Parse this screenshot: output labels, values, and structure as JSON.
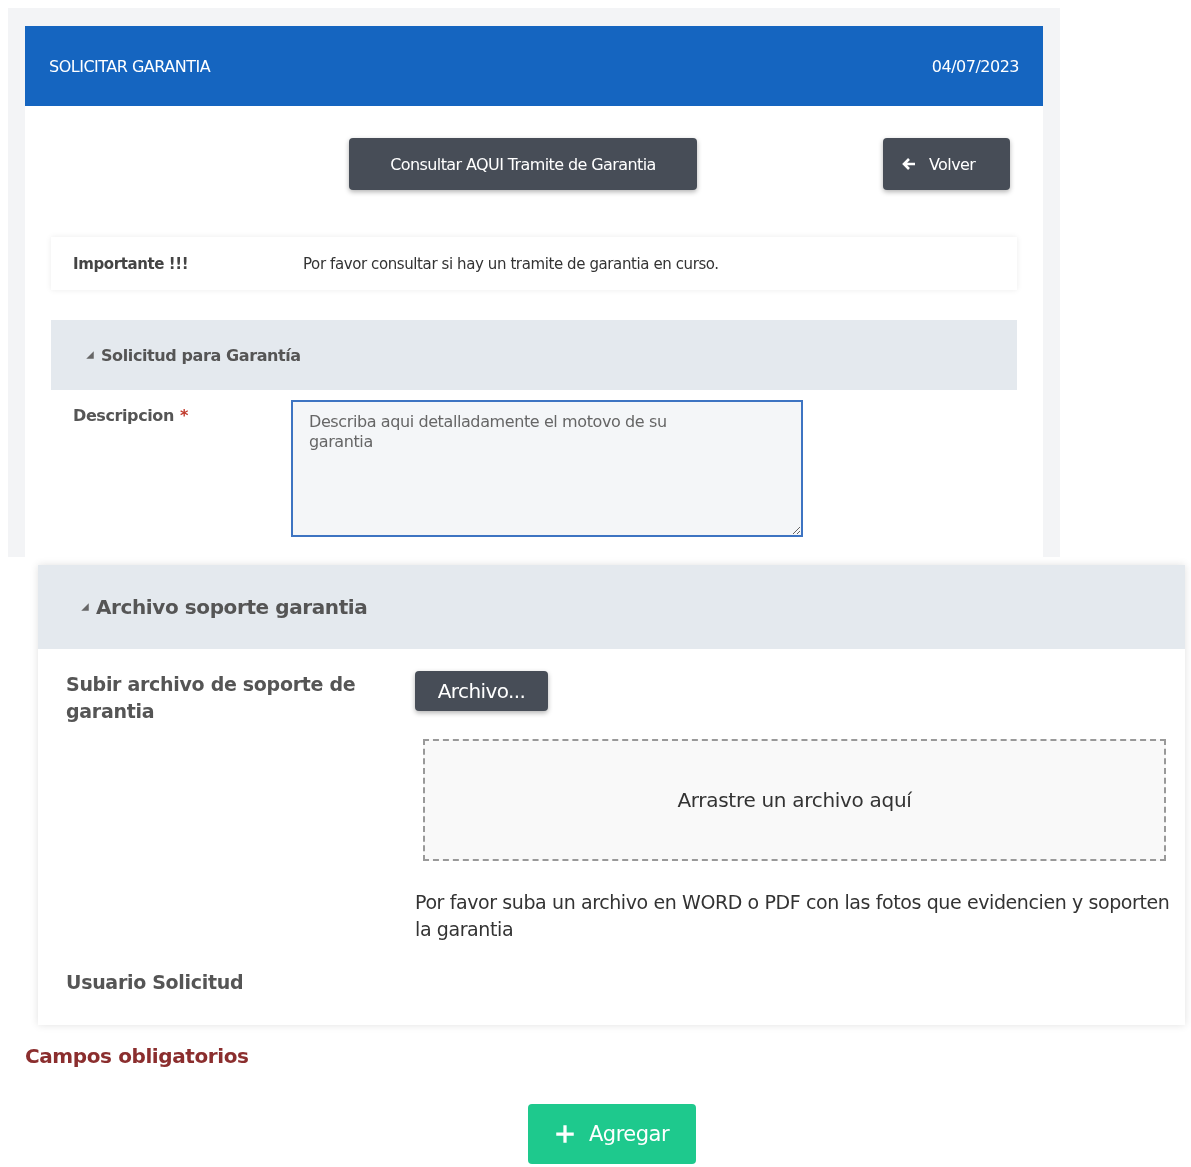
{
  "header": {
    "title": "SOLICITAR GARANTIA",
    "date": "04/07/2023"
  },
  "top_buttons": [
    {
      "label": "Consultar AQUI Tramite de Garantia",
      "kind": "plain"
    },
    {
      "label": "Volver",
      "kind": "back"
    }
  ],
  "notice": {
    "label": "Importante !!!",
    "text": "Por favor consultar si hay un tramite de garantia en curso."
  },
  "request_section": {
    "title": "Solicitud para Garantía",
    "expanded": true,
    "description": {
      "label": "Descripcion",
      "required": true,
      "required_mark": "*",
      "placeholder": "Describa aqui detalladamente el motovo de su garantia"
    }
  },
  "file_section": {
    "title": "Archivo soporte garantia",
    "expanded": true,
    "upload": {
      "label": "Subir archivo de soporte de garantia",
      "button": "Archivo...",
      "dropzone": "Arrastre un archivo aquí",
      "help": "Por favor suba un archivo en WORD o PDF con las fotos que evidencien y soporten la garantia"
    },
    "user_label": "Usuario Solicitud"
  },
  "required_note": "Campos obligatorios",
  "submit_button": "Agregar"
}
